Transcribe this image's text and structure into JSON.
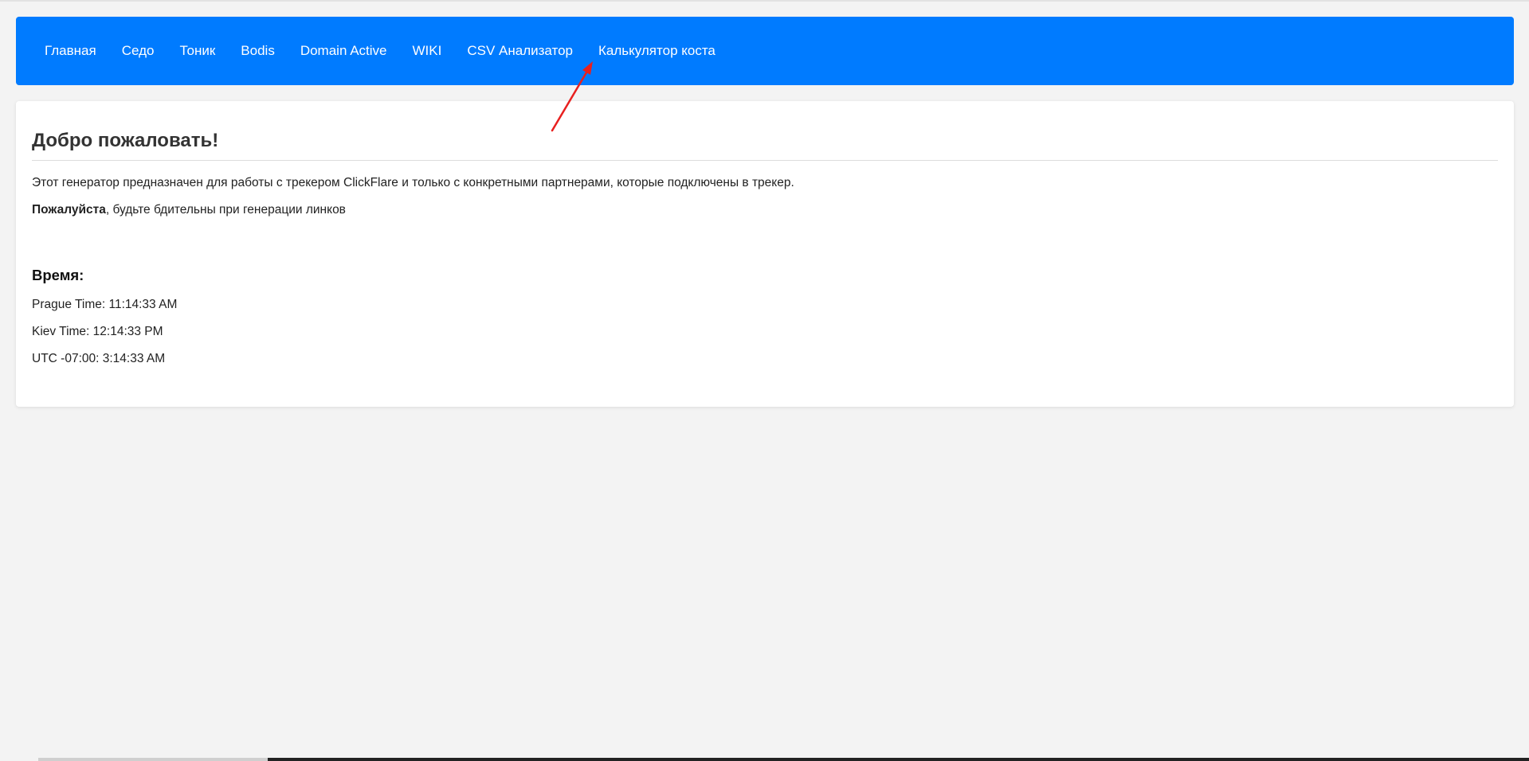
{
  "nav": {
    "items": [
      {
        "label": "Главная"
      },
      {
        "label": "Седо"
      },
      {
        "label": "Тоник"
      },
      {
        "label": "Bodis"
      },
      {
        "label": "Domain Active"
      },
      {
        "label": "WIKI"
      },
      {
        "label": "CSV Анализатор"
      },
      {
        "label": "Калькулятор коста"
      }
    ]
  },
  "main": {
    "title": "Добро пожаловать!",
    "intro": "Этот генератор предназначен для работы с трекером ClickFlare и только с конкретными партнерами, которые подключены в трекер.",
    "notice_bold": "Пожалуйста",
    "notice_rest": ", будьте бдительны при генерации линков"
  },
  "time": {
    "heading": "Время:",
    "rows": [
      {
        "label": "Prague Time: 11:14:33 AM"
      },
      {
        "label": "Kiev Time: 12:14:33 PM"
      },
      {
        "label": "UTC -07:00: 3:14:33 AM"
      }
    ]
  },
  "colors": {
    "navbar": "#007bff",
    "background": "#f3f3f3",
    "annotation_arrow": "#e8201f"
  }
}
